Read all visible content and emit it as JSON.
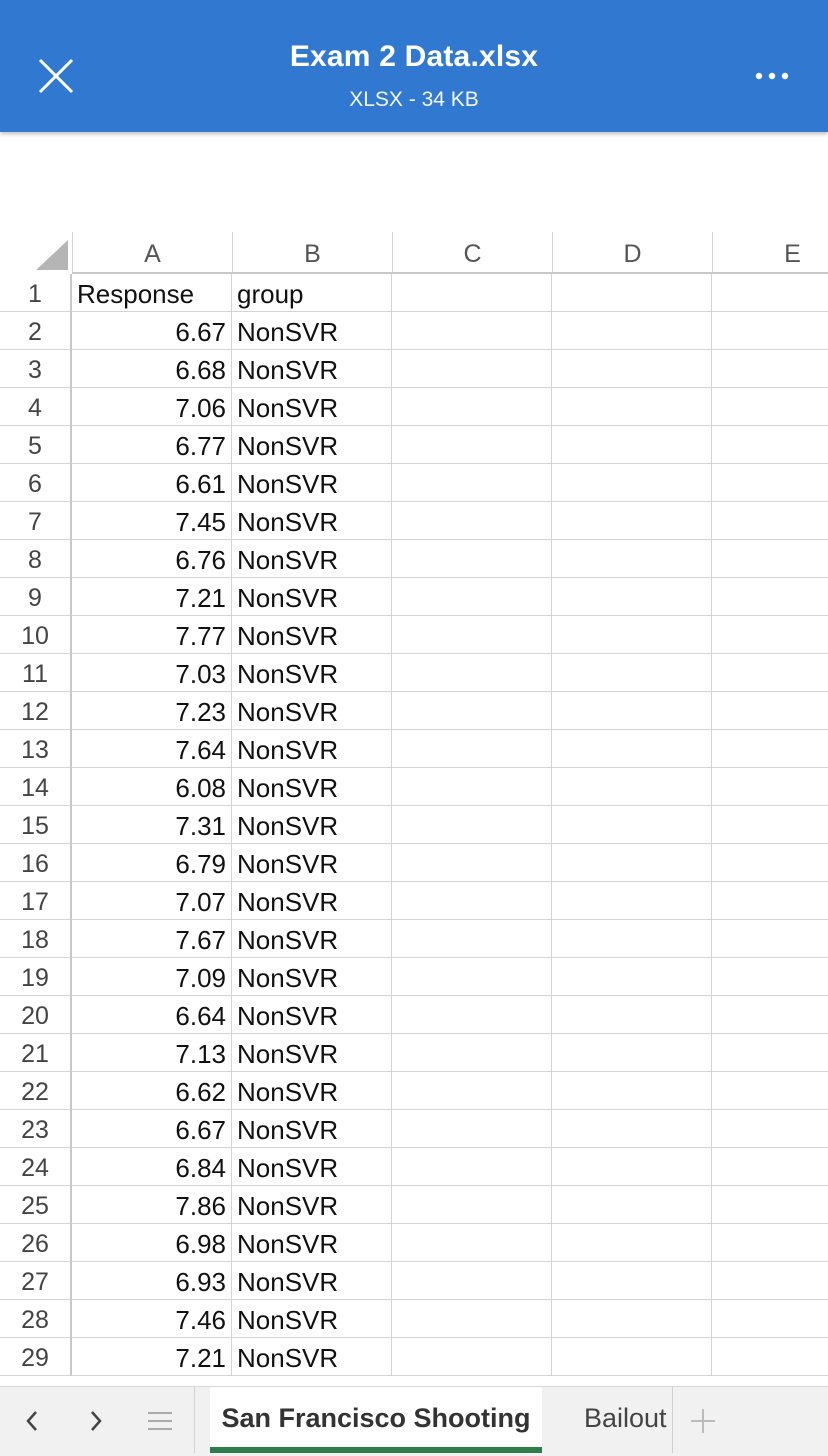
{
  "header": {
    "title": "Exam 2 Data.xlsx",
    "subtitle": "XLSX - 34 KB",
    "close_icon": "close-icon",
    "more_icon": "more-options-icon",
    "color": "#3178d0"
  },
  "sheet": {
    "columns": [
      "A",
      "B",
      "C",
      "D",
      "E"
    ],
    "rows": [
      {
        "num": "1",
        "a": "Response",
        "b": "group"
      },
      {
        "num": "2",
        "a": "6.67",
        "b": "NonSVR"
      },
      {
        "num": "3",
        "a": "6.68",
        "b": "NonSVR"
      },
      {
        "num": "4",
        "a": "7.06",
        "b": "NonSVR"
      },
      {
        "num": "5",
        "a": "6.77",
        "b": "NonSVR"
      },
      {
        "num": "6",
        "a": "6.61",
        "b": "NonSVR"
      },
      {
        "num": "7",
        "a": "7.45",
        "b": "NonSVR"
      },
      {
        "num": "8",
        "a": "6.76",
        "b": "NonSVR"
      },
      {
        "num": "9",
        "a": "7.21",
        "b": "NonSVR"
      },
      {
        "num": "10",
        "a": "7.77",
        "b": "NonSVR"
      },
      {
        "num": "11",
        "a": "7.03",
        "b": "NonSVR"
      },
      {
        "num": "12",
        "a": "7.23",
        "b": "NonSVR"
      },
      {
        "num": "13",
        "a": "7.64",
        "b": "NonSVR"
      },
      {
        "num": "14",
        "a": "6.08",
        "b": "NonSVR"
      },
      {
        "num": "15",
        "a": "7.31",
        "b": "NonSVR"
      },
      {
        "num": "16",
        "a": "6.79",
        "b": "NonSVR"
      },
      {
        "num": "17",
        "a": "7.07",
        "b": "NonSVR"
      },
      {
        "num": "18",
        "a": "7.67",
        "b": "NonSVR"
      },
      {
        "num": "19",
        "a": "7.09",
        "b": "NonSVR"
      },
      {
        "num": "20",
        "a": "6.64",
        "b": "NonSVR"
      },
      {
        "num": "21",
        "a": "7.13",
        "b": "NonSVR"
      },
      {
        "num": "22",
        "a": "6.62",
        "b": "NonSVR"
      },
      {
        "num": "23",
        "a": "6.67",
        "b": "NonSVR"
      },
      {
        "num": "24",
        "a": "6.84",
        "b": "NonSVR"
      },
      {
        "num": "25",
        "a": "7.86",
        "b": "NonSVR"
      },
      {
        "num": "26",
        "a": "6.98",
        "b": "NonSVR"
      },
      {
        "num": "27",
        "a": "6.93",
        "b": "NonSVR"
      },
      {
        "num": "28",
        "a": "7.46",
        "b": "NonSVR"
      },
      {
        "num": "29",
        "a": "7.21",
        "b": "NonSVR"
      }
    ]
  },
  "tabs": {
    "prev_icon": "chevron-left-icon",
    "next_icon": "chevron-right-icon",
    "list_icon": "sheet-list-icon",
    "add_icon": "plus-icon",
    "sheets": [
      {
        "label": "San Francisco Shooting",
        "active": true
      },
      {
        "label": "Bailout",
        "active": false
      }
    ],
    "active_color": "#2e7d4b"
  }
}
